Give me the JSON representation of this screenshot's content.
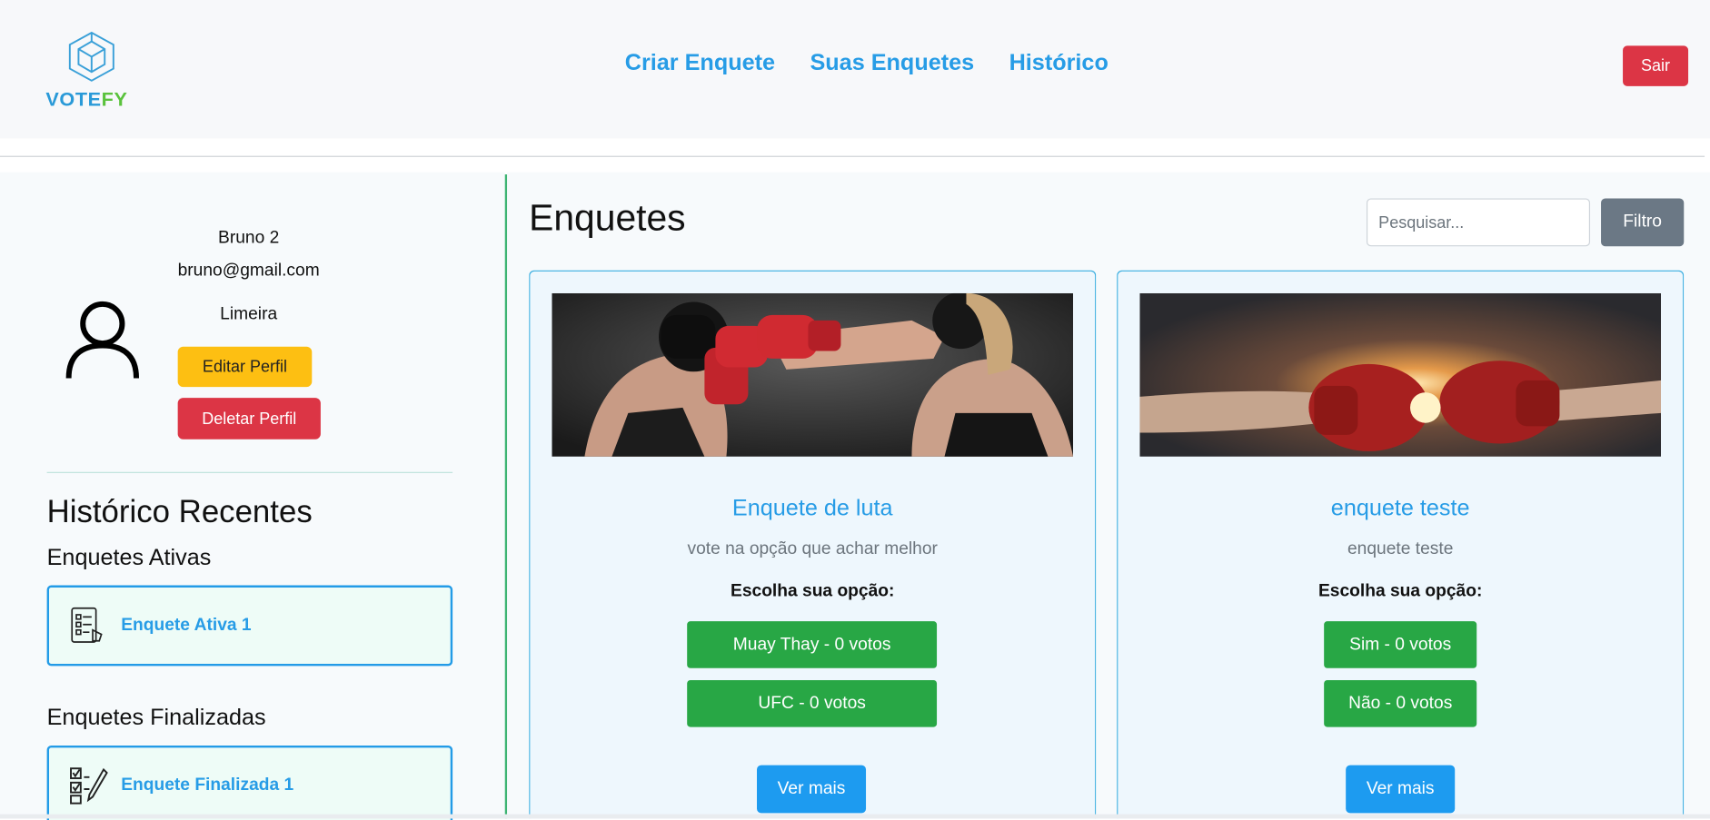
{
  "brand": {
    "word_blue": "VOTE",
    "word_green": "FY",
    "logo_icon": "cube-icon"
  },
  "nav": {
    "links": [
      "Criar Enquete",
      "Suas Enquetes",
      "Histórico"
    ],
    "logout": "Sair"
  },
  "profile": {
    "name": "Bruno 2",
    "email": "bruno@gmail.com",
    "city": "Limeira",
    "avatar_icon": "user-icon",
    "edit_label": "Editar Perfil",
    "delete_label": "Deletar Perfil"
  },
  "history": {
    "title": "Histórico Recentes",
    "active_title": "Enquetes Ativas",
    "active_item": "Enquete Ativa 1",
    "finished_title": "Enquetes Finalizadas",
    "finished_item": "Enquete Finalizada 1"
  },
  "main": {
    "title": "Enquetes",
    "search_placeholder": "Pesquisar...",
    "filter_label": "Filtro"
  },
  "polls": [
    {
      "title": "Enquete de luta",
      "description": "vote na opção que achar melhor",
      "choose": "Escolha sua opção:",
      "options": [
        "Muay Thay - 0 votos",
        "UFC - 0 votos"
      ],
      "more": "Ver mais"
    },
    {
      "title": "enquete teste",
      "description": "enquete teste",
      "choose": "Escolha sua opção:",
      "options": [
        "Sim - 0 votos",
        "Não - 0 votos"
      ],
      "more": "Ver mais"
    }
  ],
  "colors": {
    "primary": "#279ce6",
    "danger": "#dc3545",
    "warning": "#fdbf12",
    "success": "#28a745",
    "secondary": "#6b7885"
  }
}
